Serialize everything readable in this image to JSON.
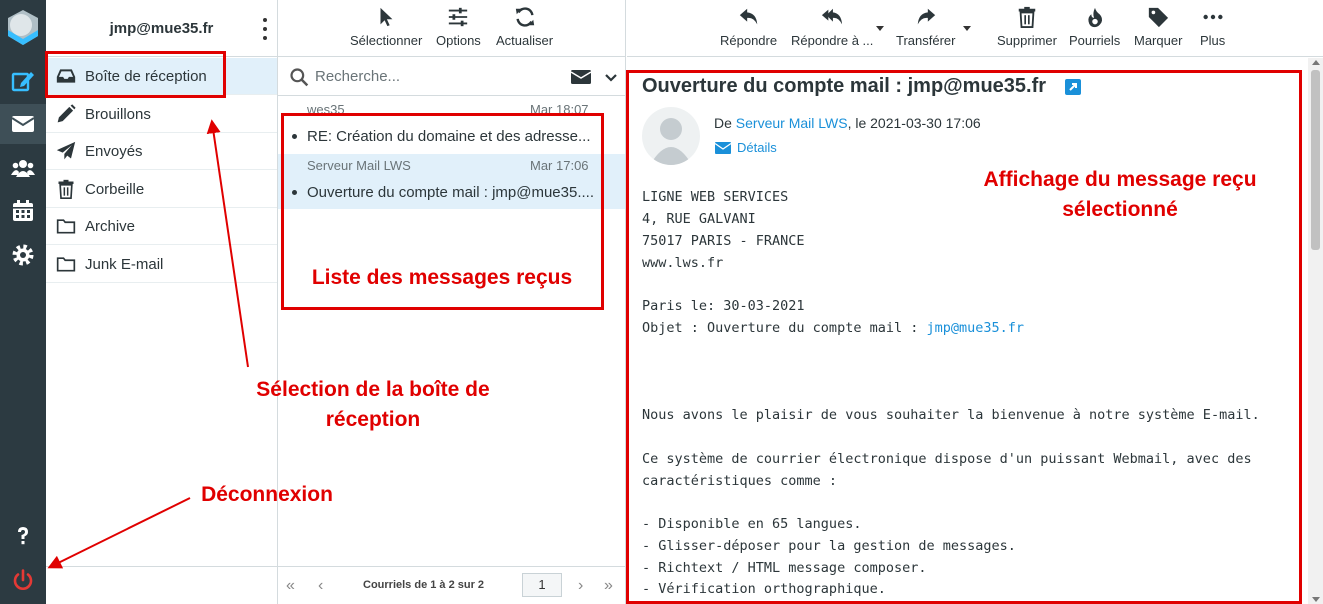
{
  "account": {
    "email": "jmp@mue35.fr"
  },
  "folders": [
    {
      "label": "Boîte de réception",
      "icon": "inbox-icon",
      "selected": true
    },
    {
      "label": "Brouillons",
      "icon": "pencil-icon"
    },
    {
      "label": "Envoyés",
      "icon": "paper-plane-icon"
    },
    {
      "label": "Corbeille",
      "icon": "trash-icon"
    },
    {
      "label": "Archive",
      "icon": "folder-icon"
    },
    {
      "label": "Junk E-mail",
      "icon": "folder-icon"
    }
  ],
  "list_toolbar": {
    "select_label": "Sélectionner",
    "options_label": "Options",
    "refresh_label": "Actualiser"
  },
  "search": {
    "placeholder": "Recherche..."
  },
  "messages": [
    {
      "sender": "wes35",
      "date": "Mar 18:07",
      "subject": "RE: Création du domaine et des adresse..."
    },
    {
      "sender": "Serveur Mail LWS",
      "date": "Mar 17:06",
      "subject": "Ouverture du compte mail : jmp@mue35...."
    }
  ],
  "pager": {
    "count_label": "Courriels de 1 à 2 sur 2",
    "page": "1"
  },
  "mail_toolbar": {
    "reply_label": "Répondre",
    "reply_all_label": "Répondre à ...",
    "forward_label": "Transférer",
    "delete_label": "Supprimer",
    "spam_label": "Pourriels",
    "mark_label": "Marquer",
    "more_label": "Plus"
  },
  "mail": {
    "subject": "Ouverture du compte mail : jmp@mue35.fr",
    "from_prefix": "De ",
    "from_name": "Serveur Mail LWS",
    "from_suffix": ", le 2021-03-30 17:06",
    "details_label": "Détails",
    "body": {
      "line1": "LIGNE WEB SERVICES",
      "line2": "4, RUE GALVANI",
      "line3": "75017 PARIS - FRANCE",
      "line4_link": "www.lws.fr",
      "line5": "Paris le: 30-03-2021",
      "line6_prefix": "Objet : Ouverture du compte mail : ",
      "line6_link": "jmp@mue35.fr",
      "line7": "Nous avons le plaisir de vous souhaiter la bienvenue à notre système E-mail.",
      "line8": "Ce système de courrier électronique dispose d'un puissant Webmail, avec des",
      "line9": "caractéristiques comme :",
      "line10": "- Disponible en 65 langues.",
      "line11": "- Glisser-déposer pour la gestion de messages.",
      "line12": "- Richtext / HTML message composer.",
      "line13": "- Vérification orthographique."
    }
  },
  "annotations": {
    "inbox_selection_1": "Sélection de la boîte de",
    "inbox_selection_2": "réception",
    "message_list": "Liste des messages reçus",
    "message_display_1": "Affichage du message reçu",
    "message_display_2": "sélectionné",
    "logout": "Déconnexion"
  },
  "colors": {
    "annotation_red": "#e00000",
    "sidebar_dark": "#2c3a41",
    "selection_blue": "#e1f0fa",
    "link_blue": "#1a90d9",
    "logout_red": "#e53935"
  }
}
